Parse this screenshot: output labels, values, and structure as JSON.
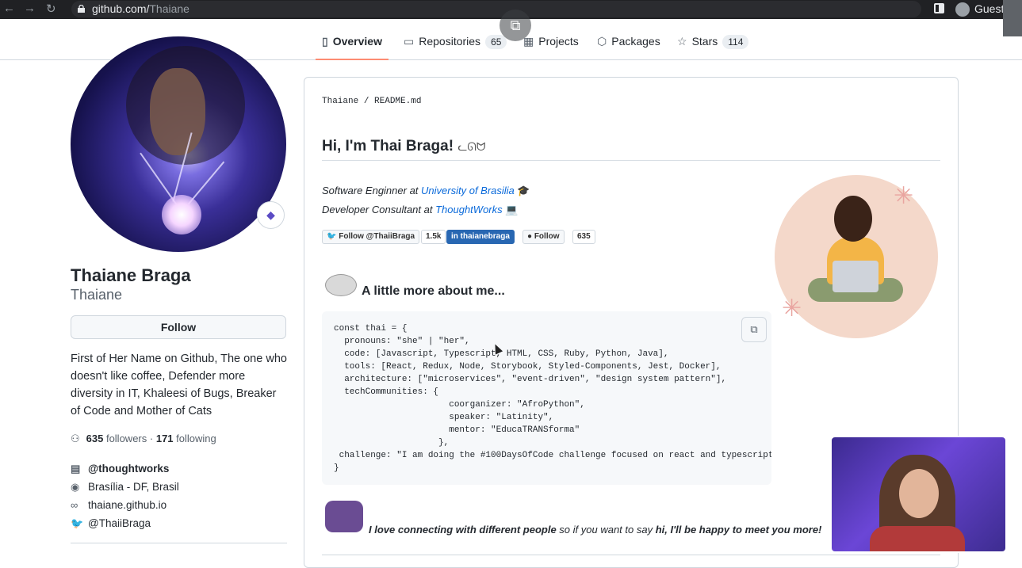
{
  "browser": {
    "url_host": "github.com/",
    "url_path": "Thaiane",
    "profile": "Guest"
  },
  "tabs": [
    {
      "label": "Overview",
      "icon": "book-icon"
    },
    {
      "label": "Repositories",
      "icon": "repo-icon",
      "count": "65"
    },
    {
      "label": "Projects",
      "icon": "project-icon"
    },
    {
      "label": "Packages",
      "icon": "package-icon"
    },
    {
      "label": "Stars",
      "icon": "star-icon",
      "count": "114"
    }
  ],
  "profile": {
    "name": "Thaiane Braga",
    "login": "Thaiane",
    "follow_label": "Follow",
    "bio": "First of Her Name on Github, The one who doesn't like coffee, Defender more diversity in IT, Khaleesi of Bugs, Breaker of Code and Mother of Cats",
    "followers": "635",
    "followers_label": "followers",
    "separator": "·",
    "following": "171",
    "following_label": "following",
    "company": "@thoughtworks",
    "location": "Brasília - DF, Brasil",
    "website": "thaiane.github.io",
    "twitter": "@ThaiiBraga"
  },
  "readme": {
    "path_user": "Thaiane",
    "path_sep": " / ",
    "path_file": "README.md",
    "heading": "Hi, I'm Thai Braga!",
    "line1_prefix": "Software Enginner at ",
    "line1_link": "University of Brasilia",
    "line2_prefix": "Developer Consultant at ",
    "line2_link": "ThoughtWorks",
    "badges": {
      "twitter": "Follow @ThaiiBraga",
      "twitter_count": "1.5k",
      "linkedin": "thaianebraga",
      "github": "Follow",
      "github_count": "635"
    },
    "section_title": "A little more about me...",
    "code_lines": [
      "const thai = {",
      "  pronouns: \"she\" | \"her\",",
      "  code: [Javascript, Typescript, HTML, CSS, Ruby, Python, Java],",
      "  tools: [React, Redux, Node, Storybook, Styled-Components, Jest, Docker],",
      "  architecture: [\"microservices\", \"event-driven\", \"design system pattern\"],",
      "  techCommunities: {",
      "                      coorganizer: \"AfroPython\",",
      "                      speaker: \"Latinity\",",
      "                      mentor: \"EducaTRANSforma\"",
      "                    },",
      " challenge: \"I am doing the #100DaysOfCode challenge focused on react and typescript\"",
      "}"
    ],
    "connect_bold": "I love connecting with different people",
    "connect_mid": " so if you want to say ",
    "connect_end": "hi, I'll be happy to meet you more!"
  }
}
